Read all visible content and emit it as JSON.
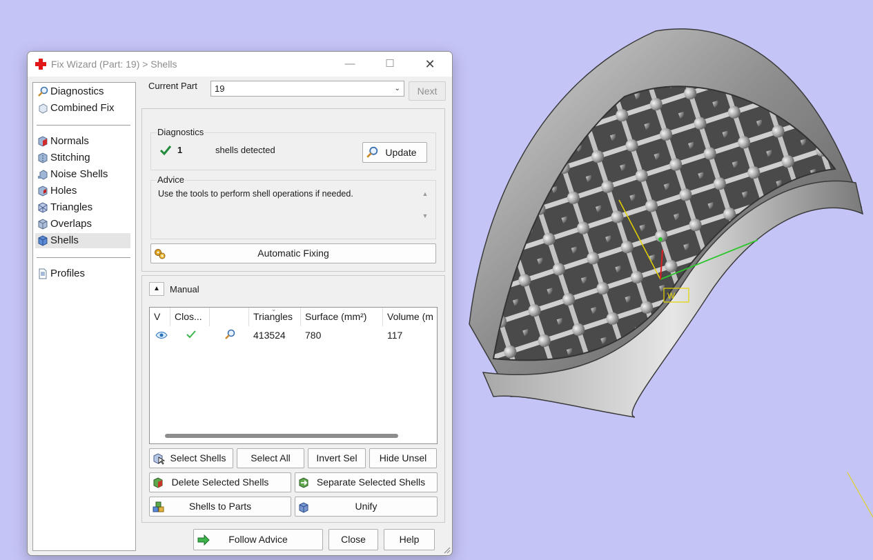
{
  "window": {
    "title": "Fix Wizard (Part: 19) > Shells",
    "minimize": "—",
    "maximize": "☐",
    "close": "✕"
  },
  "nav": {
    "items": [
      {
        "label": "Diagnostics",
        "icon": "magnifier-icon"
      },
      {
        "label": "Combined Fix",
        "icon": "cube-outline-icon"
      },
      {
        "label": "Normals",
        "icon": "cube-red-face-icon"
      },
      {
        "label": "Stitching",
        "icon": "cube-stitch-icon"
      },
      {
        "label": "Noise Shells",
        "icon": "cube-noise-icon"
      },
      {
        "label": "Holes",
        "icon": "cube-hole-icon"
      },
      {
        "label": "Triangles",
        "icon": "cube-triangles-icon"
      },
      {
        "label": "Overlaps",
        "icon": "cube-overlap-icon"
      },
      {
        "label": "Shells",
        "icon": "cube-blue-icon",
        "selected": true
      },
      {
        "label": "Profiles",
        "icon": "document-icon"
      }
    ]
  },
  "current_part": {
    "label": "Current Part",
    "value": "19",
    "next_label": "Next"
  },
  "diagnostics": {
    "title": "Diagnostics",
    "count": "1",
    "text": "shells detected",
    "update_label": "Update"
  },
  "advice": {
    "title": "Advice",
    "text": "Use the tools to perform shell operations if needed."
  },
  "automatic_fixing_label": "Automatic Fixing",
  "manual": {
    "title": "Manual",
    "columns": [
      "V",
      "Clos...",
      "",
      "Triangles",
      "Surface (mm²)",
      "Volume (m"
    ],
    "rows": [
      {
        "triangles": "413524",
        "surface": "780",
        "volume": "117"
      }
    ],
    "buttons": {
      "select_shells": "Select Shells",
      "select_all": "Select All",
      "invert_sel": "Invert Sel",
      "hide_unsel": "Hide Unsel",
      "delete_selected": "Delete Selected Shells",
      "separate_selected": "Separate Selected Shells",
      "shells_to_parts": "Shells to Parts",
      "unify": "Unify"
    }
  },
  "footer": {
    "follow_advice": "Follow Advice",
    "close": "Close",
    "help": "Help"
  },
  "viewport": {
    "axis_label": "W",
    "background": "#c5c4f7"
  }
}
